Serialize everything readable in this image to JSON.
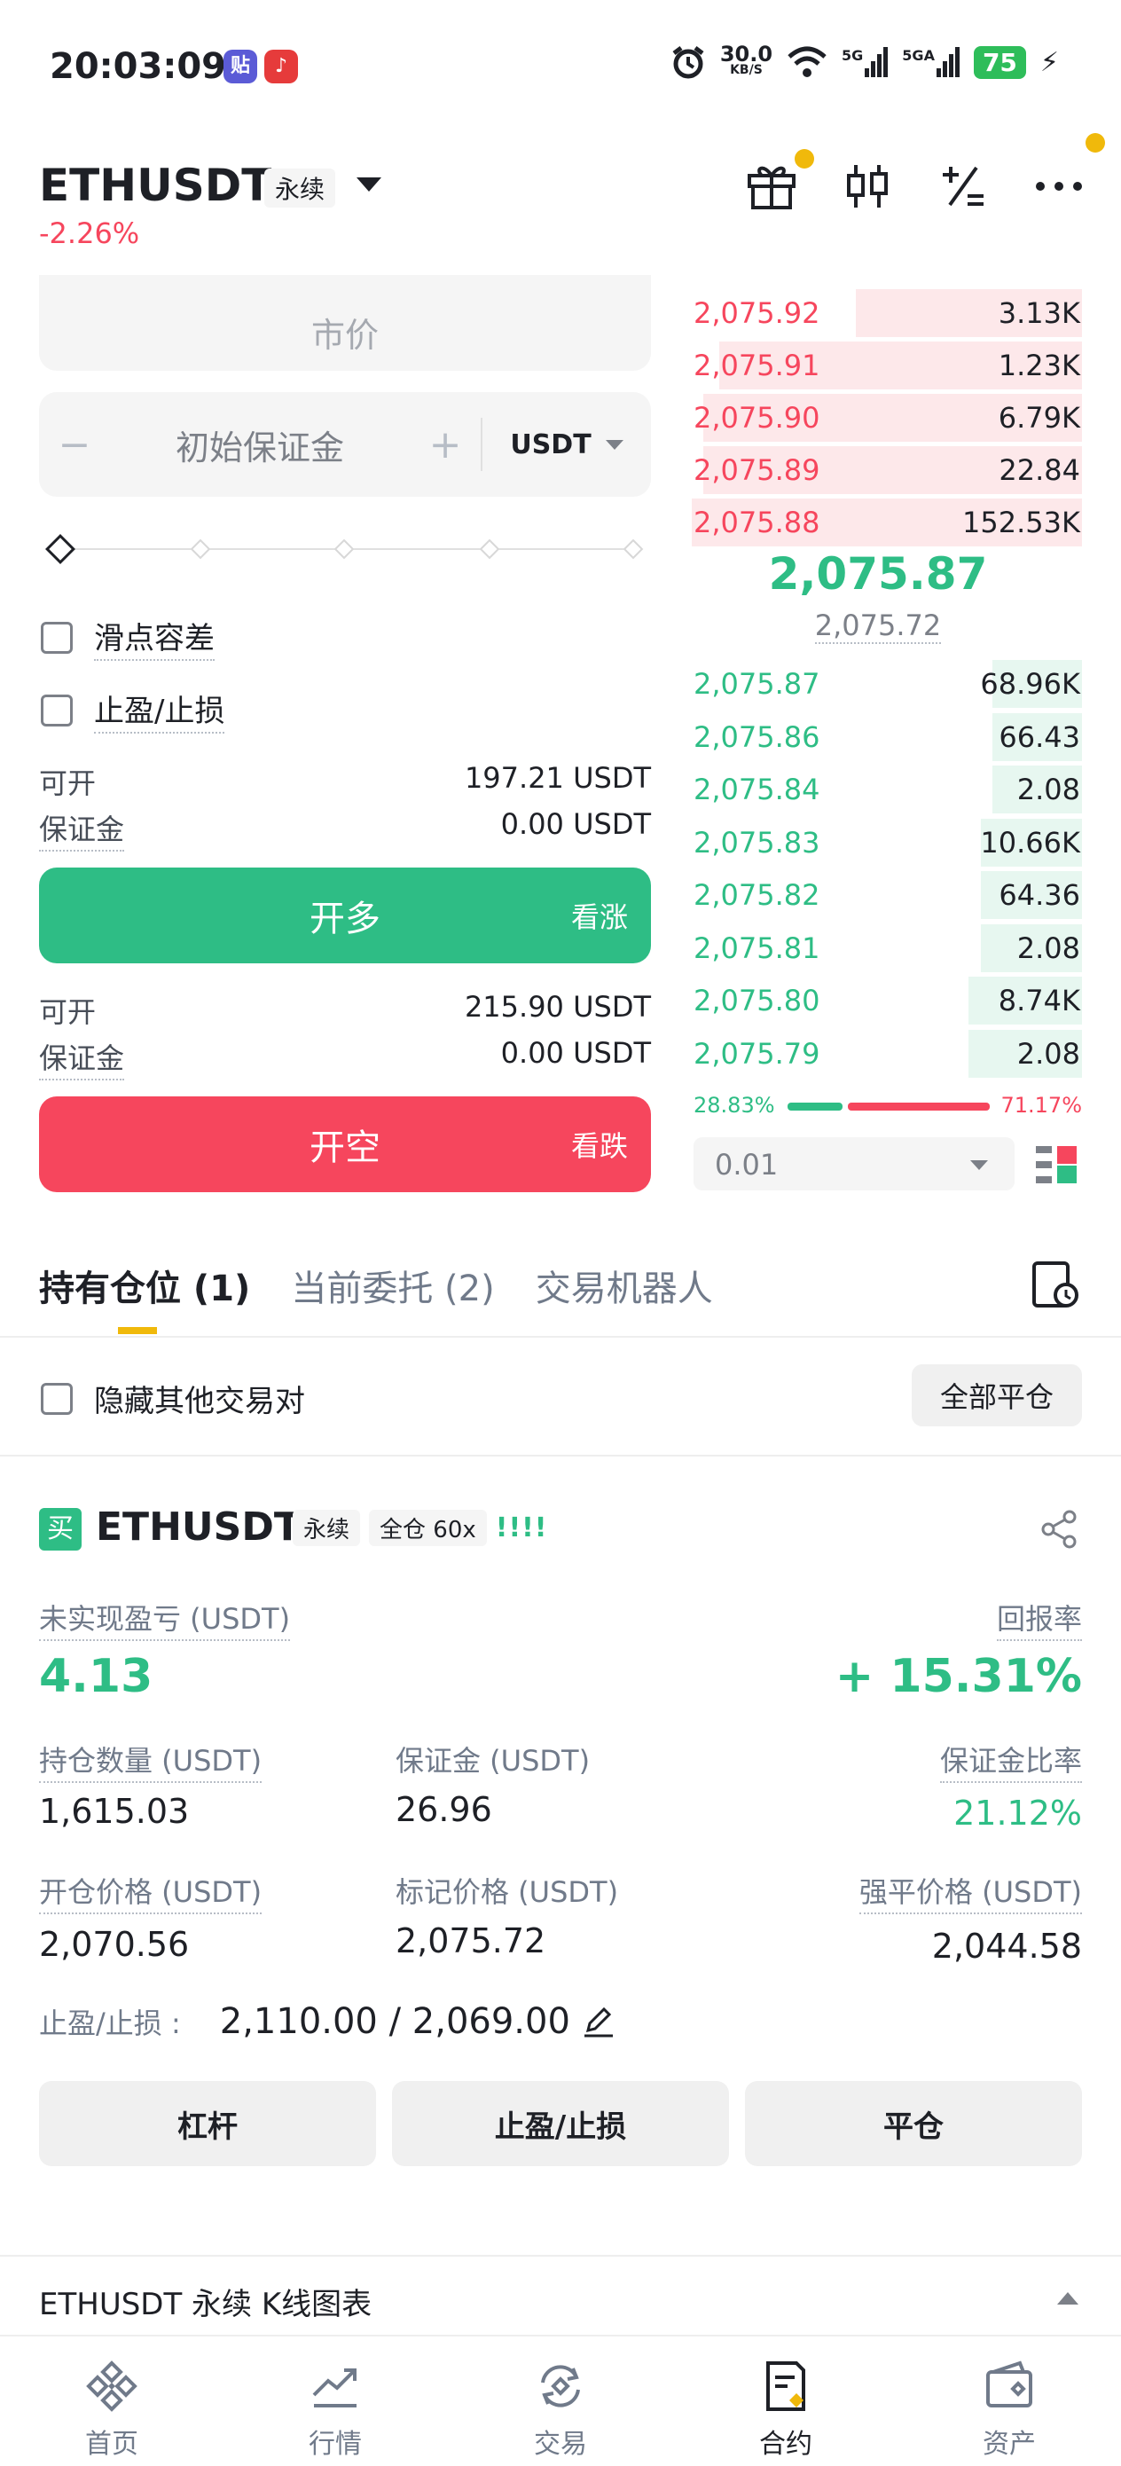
{
  "status_bar": {
    "time": "20:03:09",
    "app1": "贴",
    "net_speed_value": "30.0",
    "net_speed_unit": "KB/S",
    "sig1": "5G",
    "sig2": "5GA",
    "battery": "75"
  },
  "header": {
    "symbol": "ETHUSDT",
    "contract_tag": "永续",
    "change": "-2.26%"
  },
  "order_form": {
    "order_type": "市价",
    "margin_placeholder": "初始保证金",
    "minus": "−",
    "plus": "+",
    "unit": "USDT",
    "slippage_label": "滑点容差",
    "tpsl_label": "止盈/止损",
    "long": {
      "avail_label": "可开",
      "avail_value": "197.21 USDT",
      "margin_label": "保证金",
      "margin_value": "0.00 USDT",
      "button": "开多",
      "side": "看涨"
    },
    "short": {
      "avail_label": "可开",
      "avail_value": "215.90 USDT",
      "margin_label": "保证金",
      "margin_value": "0.00 USDT",
      "button": "开空",
      "side": "看跌"
    }
  },
  "order_book": {
    "asks": [
      {
        "price": "2,075.92",
        "qty": "3.13K",
        "depth": 0.58
      },
      {
        "price": "2,075.91",
        "qty": "1.23K",
        "depth": 0.93
      },
      {
        "price": "2,075.90",
        "qty": "6.79K",
        "depth": 0.97
      },
      {
        "price": "2,075.89",
        "qty": "22.84",
        "depth": 0.97
      },
      {
        "price": "2,075.88",
        "qty": "152.53K",
        "depth": 1.0
      }
    ],
    "last_price": "2,075.87",
    "mark_price": "2,075.72",
    "bids": [
      {
        "price": "2,075.87",
        "qty": "68.96K",
        "depth": 0.23
      },
      {
        "price": "2,075.86",
        "qty": "66.43",
        "depth": 0.23
      },
      {
        "price": "2,075.84",
        "qty": "2.08",
        "depth": 0.23
      },
      {
        "price": "2,075.83",
        "qty": "10.66K",
        "depth": 0.26
      },
      {
        "price": "2,075.82",
        "qty": "64.36",
        "depth": 0.26
      },
      {
        "price": "2,075.81",
        "qty": "2.08",
        "depth": 0.26
      },
      {
        "price": "2,075.80",
        "qty": "8.74K",
        "depth": 0.29
      },
      {
        "price": "2,075.79",
        "qty": "2.08",
        "depth": 0.29
      }
    ],
    "buy_ratio": "28.83%",
    "sell_ratio": "71.17%",
    "precision": "0.01"
  },
  "tabs": [
    {
      "label": "持有仓位 (1)"
    },
    {
      "label": "当前委托 (2)"
    },
    {
      "label": "交易机器人"
    }
  ],
  "positions_panel": {
    "hide_others": "隐藏其他交易对",
    "close_all": "全部平仓"
  },
  "position": {
    "side_badge": "买",
    "symbol": "ETHUSDT",
    "contract_tag": "永续",
    "mode_tag": "全仓 60x",
    "signal": "!!!!",
    "pnl_label": "未实现盈亏 (USDT)",
    "pnl_value": "4.13",
    "roe_label": "回报率",
    "roe_value": "+ 15.31%",
    "size_label": "持仓数量 (USDT)",
    "size_value": "1,615.03",
    "margin_label": "保证金 (USDT)",
    "margin_value": "26.96",
    "margin_ratio_label": "保证金比率",
    "margin_ratio_value": "21.12%",
    "entry_label": "开仓价格 (USDT)",
    "entry_value": "2,070.56",
    "mark_label": "标记价格 (USDT)",
    "mark_value": "2,075.72",
    "liq_label": "强平价格 (USDT)",
    "liq_value": "2,044.58",
    "tpsl_label": "止盈/止损 :",
    "tpsl_value": "2,110.00 / 2,069.00",
    "btn_leverage": "杠杆",
    "btn_tpsl": "止盈/止损",
    "btn_close": "平仓"
  },
  "kline_bar": {
    "label": "ETHUSDT 永续 K线图表"
  },
  "nav": [
    {
      "label": "首页",
      "icon": "home-icon"
    },
    {
      "label": "行情",
      "icon": "markets-icon"
    },
    {
      "label": "交易",
      "icon": "trade-icon"
    },
    {
      "label": "合约",
      "icon": "futures-icon"
    },
    {
      "label": "资产",
      "icon": "wallet-icon"
    }
  ],
  "colors": {
    "green": "#2ebd85",
    "red": "#f6465d",
    "accent": "#f0b90b"
  }
}
